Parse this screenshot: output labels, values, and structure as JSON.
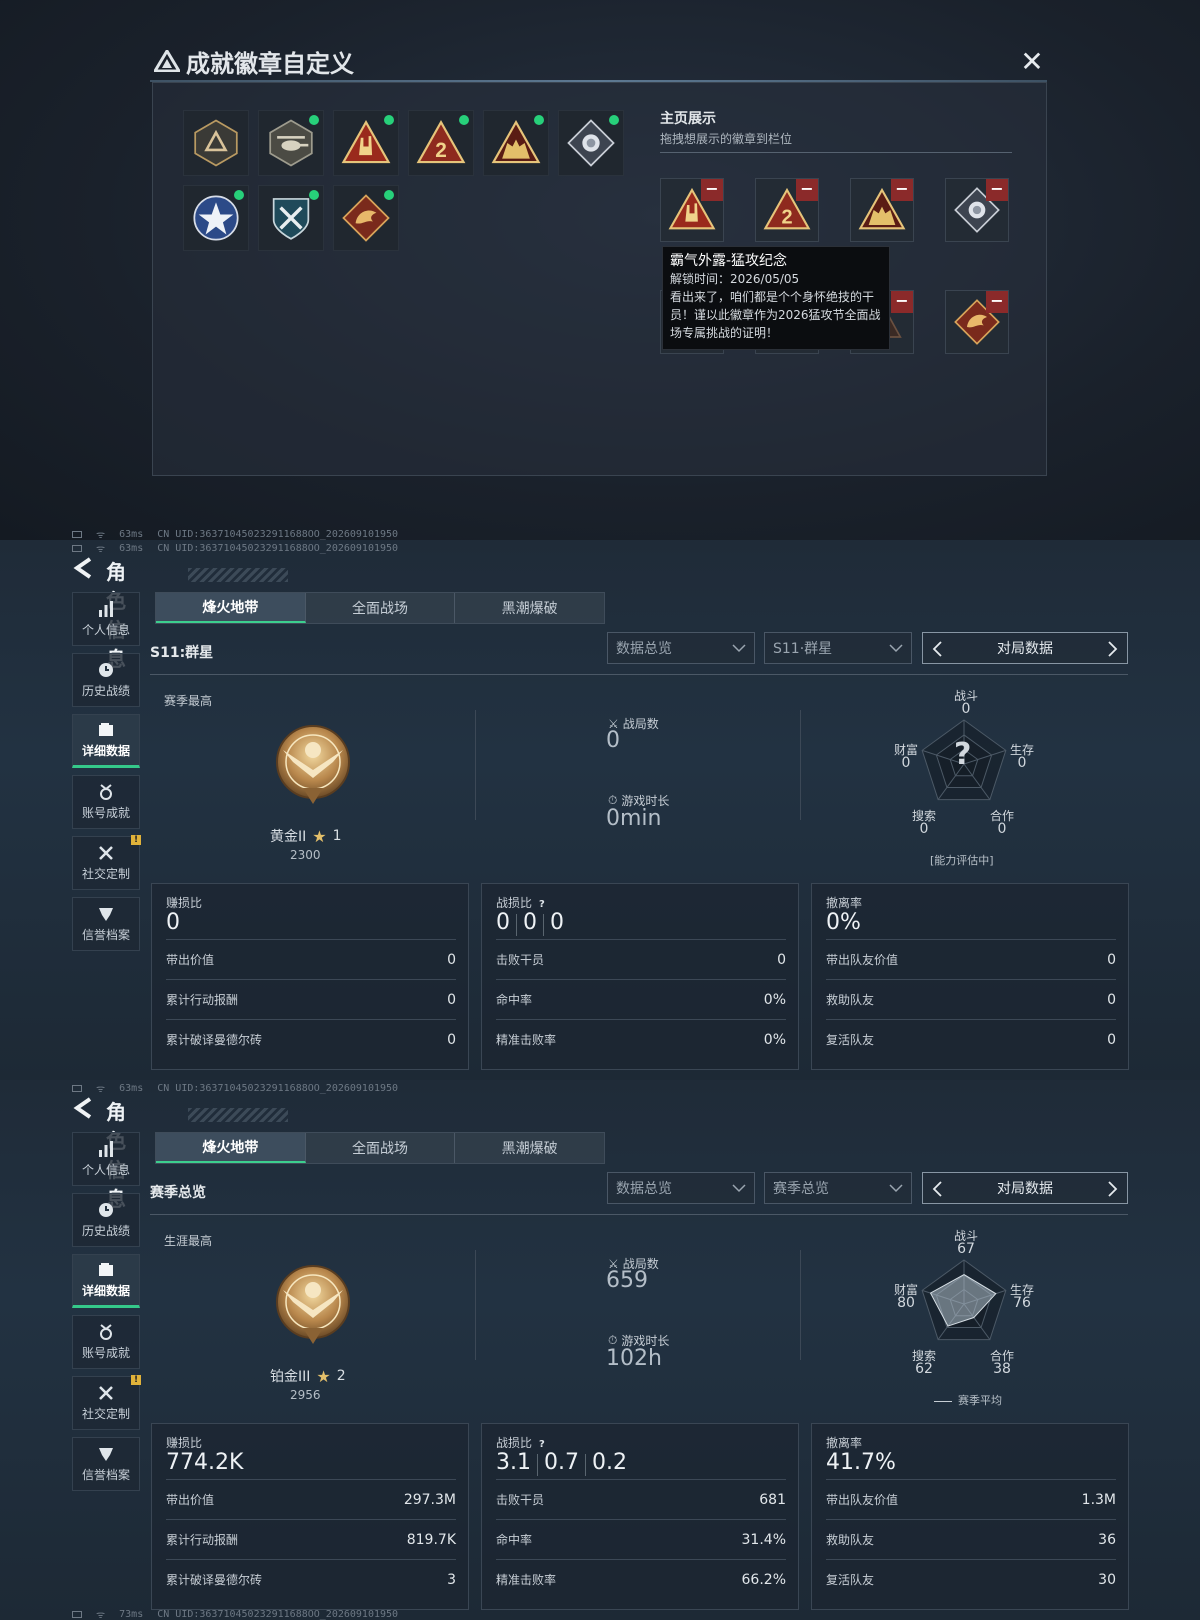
{
  "panel1": {
    "status": {
      "ping": "63ms",
      "uid": "CN UID:363710450232911688OO_202609101950"
    },
    "modal": {
      "title": "成就徽章自定义",
      "close_label": "✕",
      "showcase_title": "主页展示",
      "showcase_subtitle": "拖拽想展示的徽章到栏位",
      "tooltip": {
        "title": "霸气外露-猛攻纪念",
        "unlock": "解锁时间：2026/05/05",
        "desc1": "看出来了，咱们都是个个身怀绝技的干",
        "desc2": "员！谨以此徽章作为2026猛攻节全面战",
        "desc3": "场专属挑战的证明！"
      },
      "badges": [
        {
          "icon": "triangle-emblem-badge",
          "new": false
        },
        {
          "icon": "helicopter-badge",
          "new": true
        },
        {
          "icon": "rock-hand-badge",
          "new": true
        },
        {
          "icon": "number-two-badge",
          "new": true
        },
        {
          "icon": "soldiers-badge",
          "new": true
        },
        {
          "icon": "silver-diamond-badge",
          "new": true
        },
        {
          "icon": "star-shield-badge",
          "new": true
        },
        {
          "icon": "crossed-shield-badge",
          "new": true
        },
        {
          "icon": "dragon-badge",
          "new": true
        }
      ],
      "slots": [
        {
          "icon": "rock-hand-badge"
        },
        {
          "icon": "number-two-badge"
        },
        {
          "icon": "soldiers-badge"
        },
        {
          "icon": "silver-diamond-badge"
        },
        {
          "icon": "badge-partial"
        },
        {
          "icon": "badge-partial"
        },
        {
          "icon": "badge-partial"
        },
        {
          "icon": "dragon-badge"
        }
      ]
    }
  },
  "panel2": {
    "status": {
      "ping": "63ms",
      "uid": "CN UID:363710450232911688OO_202609101950"
    },
    "title": "角色信息",
    "nav": [
      "个人信息",
      "历史战绩",
      "详细数据",
      "账号成就",
      "社交定制",
      "信誉档案"
    ],
    "tabs": [
      "烽火地带",
      "全面战场",
      "黑潮爆破"
    ],
    "season": "S11:群星",
    "dropdown1": "数据总览",
    "dropdown2": "S11·群星",
    "match_nav": "对局数据",
    "best_label": "赛季最高",
    "rank": "黄金II",
    "stars": "1",
    "score": "2300",
    "games_label": "战局数",
    "games_value": "0",
    "time_label": "游戏时长",
    "time_value": "0min",
    "radar": {
      "combat_label": "战斗",
      "combat": "0",
      "survival_label": "生存",
      "survival": "0",
      "coop_label": "合作",
      "coop": "0",
      "search_label": "搜索",
      "search": "0",
      "wealth_label": "财富",
      "wealth": "0",
      "center": "?",
      "footer": "[能力评估中]"
    },
    "card1": {
      "label": "赚损比",
      "value": "0",
      "rows": [
        {
          "l": "带出价值",
          "v": "0"
        },
        {
          "l": "累计行动报酬",
          "v": "0"
        },
        {
          "l": "累计破译曼德尔砖",
          "v": "0"
        }
      ]
    },
    "card2": {
      "label": "战损比",
      "help": "?",
      "v1": "0",
      "v2": "0",
      "v3": "0",
      "rows": [
        {
          "l": "击败干员",
          "v": "0"
        },
        {
          "l": "命中率",
          "v": "0%"
        },
        {
          "l": "精准击败率",
          "v": "0%"
        }
      ]
    },
    "card3": {
      "label": "撤离率",
      "value": "0%",
      "rows": [
        {
          "l": "带出队友价值",
          "v": "0"
        },
        {
          "l": "救助队友",
          "v": "0"
        },
        {
          "l": "复活队友",
          "v": "0"
        }
      ]
    }
  },
  "panel3": {
    "status": {
      "ping": "63ms",
      "uid": "CN UID:363710450232911688OO_202609101950"
    },
    "title": "角色信息",
    "nav": [
      "个人信息",
      "历史战绩",
      "详细数据",
      "账号成就",
      "社交定制",
      "信誉档案"
    ],
    "tabs": [
      "烽火地带",
      "全面战场",
      "黑潮爆破"
    ],
    "season": "赛季总览",
    "dropdown1": "数据总览",
    "dropdown2": "赛季总览",
    "match_nav": "对局数据",
    "best_label": "生涯最高",
    "rank": "铂金III",
    "stars": "2",
    "score": "2956",
    "games_label": "战局数",
    "games_value": "659",
    "time_label": "游戏时长",
    "time_value": "102h",
    "radar": {
      "combat_label": "战斗",
      "combat": "67",
      "survival_label": "生存",
      "survival": "76",
      "coop_label": "合作",
      "coop": "38",
      "search_label": "搜索",
      "search": "62",
      "wealth_label": "财富",
      "wealth": "80",
      "footer": "赛季平均"
    },
    "card1": {
      "label": "赚损比",
      "value": "774.2K",
      "rows": [
        {
          "l": "带出价值",
          "v": "297.3M"
        },
        {
          "l": "累计行动报酬",
          "v": "819.7K"
        },
        {
          "l": "累计破译曼德尔砖",
          "v": "3"
        }
      ]
    },
    "card2": {
      "label": "战损比",
      "help": "?",
      "v1": "3.1",
      "v2": "0.7",
      "v3": "0.2",
      "rows": [
        {
          "l": "击败干员",
          "v": "681"
        },
        {
          "l": "命中率",
          "v": "31.4%"
        },
        {
          "l": "精准击败率",
          "v": "66.2%"
        }
      ]
    },
    "card3": {
      "label": "撤离率",
      "value": "41.7%",
      "rows": [
        {
          "l": "带出队友价值",
          "v": "1.3M"
        },
        {
          "l": "救助队友",
          "v": "36"
        },
        {
          "l": "复活队友",
          "v": "30"
        }
      ]
    },
    "footer_status": {
      "ping": "73ms",
      "uid": "CN UID:363710450232911688OO_202609101950"
    }
  },
  "colors": {
    "accent_green": "#35c98a",
    "badge_dot": "#27d07a",
    "remove_red": "#8b2a2a",
    "flag_gold": "#e0b23a"
  }
}
